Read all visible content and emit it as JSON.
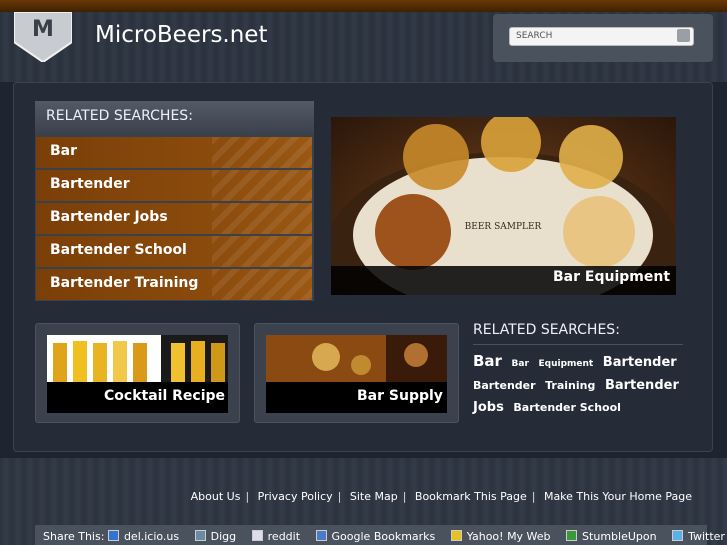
{
  "header": {
    "logo_letter": "M",
    "site_title": "MicroBeers.net",
    "search_placeholder": "SEARCH"
  },
  "related_left": {
    "title": "RELATED SEARCHES:",
    "items": [
      "Bar",
      "Bartender",
      "Bartender Jobs",
      "Bartender School",
      "Bartender Training"
    ]
  },
  "hero": {
    "image_text": "BEER SAMPLER",
    "caption": "Bar Equipment"
  },
  "tiles": [
    {
      "caption": "Cocktail Recipe"
    },
    {
      "caption": "Bar Supply"
    }
  ],
  "related_right": {
    "title": "RELATED SEARCHES:",
    "cloud": [
      {
        "text": "Bar",
        "size": "xl"
      },
      {
        "text": "Bar",
        "size": "s"
      },
      {
        "text": "Equipment",
        "size": "s"
      },
      {
        "text": "Bartender",
        "size": "l"
      },
      {
        "text": "Bartender",
        "size": "m"
      },
      {
        "text": "Training",
        "size": "m"
      },
      {
        "text": "Bartender",
        "size": "l"
      },
      {
        "text": "Jobs",
        "size": "l"
      },
      {
        "text": "Bartender School",
        "size": "m"
      }
    ]
  },
  "footer": {
    "links": [
      "About Us",
      "Privacy Policy",
      "Site Map",
      "Bookmark This Page",
      "Make This Your Home Page"
    ],
    "share_label": "Share This:",
    "share": [
      "del.icio.us",
      "Digg",
      "reddit",
      "Google Bookmarks",
      "Yahoo! My Web",
      "StumbleUpon",
      "Twitter"
    ]
  },
  "colors": {
    "accent_orange": "#8a4a0c",
    "background": "#1e2530"
  }
}
